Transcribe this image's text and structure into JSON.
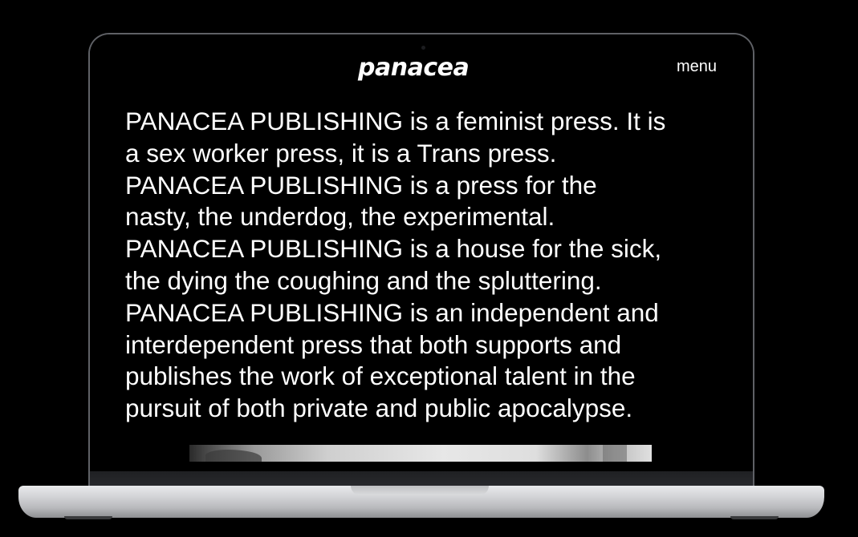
{
  "site": {
    "logo": "panacea",
    "menu_label": "menu"
  },
  "manifesto": {
    "lines": [
      "PANACEA PUBLISHING is a feminist press. It is",
      "a sex worker press, it is a Trans press.",
      "PANACEA PUBLISHING is a press for the",
      "nasty, the underdog, the experimental.",
      "PANACEA PUBLISHING is a house for the sick,",
      "the dying the coughing and the spluttering.",
      "PANACEA PUBLISHING is an independent and",
      "interdependent press that both supports and",
      "publishes the work of exceptional talent in the",
      "pursuit of both private and public apocalypse."
    ]
  },
  "colors": {
    "background": "#000000",
    "text": "#ffffff",
    "bezel_border": "#5f6166",
    "laptop_body": "#d2d3d6"
  },
  "icons": {
    "camera": "camera-dot"
  }
}
